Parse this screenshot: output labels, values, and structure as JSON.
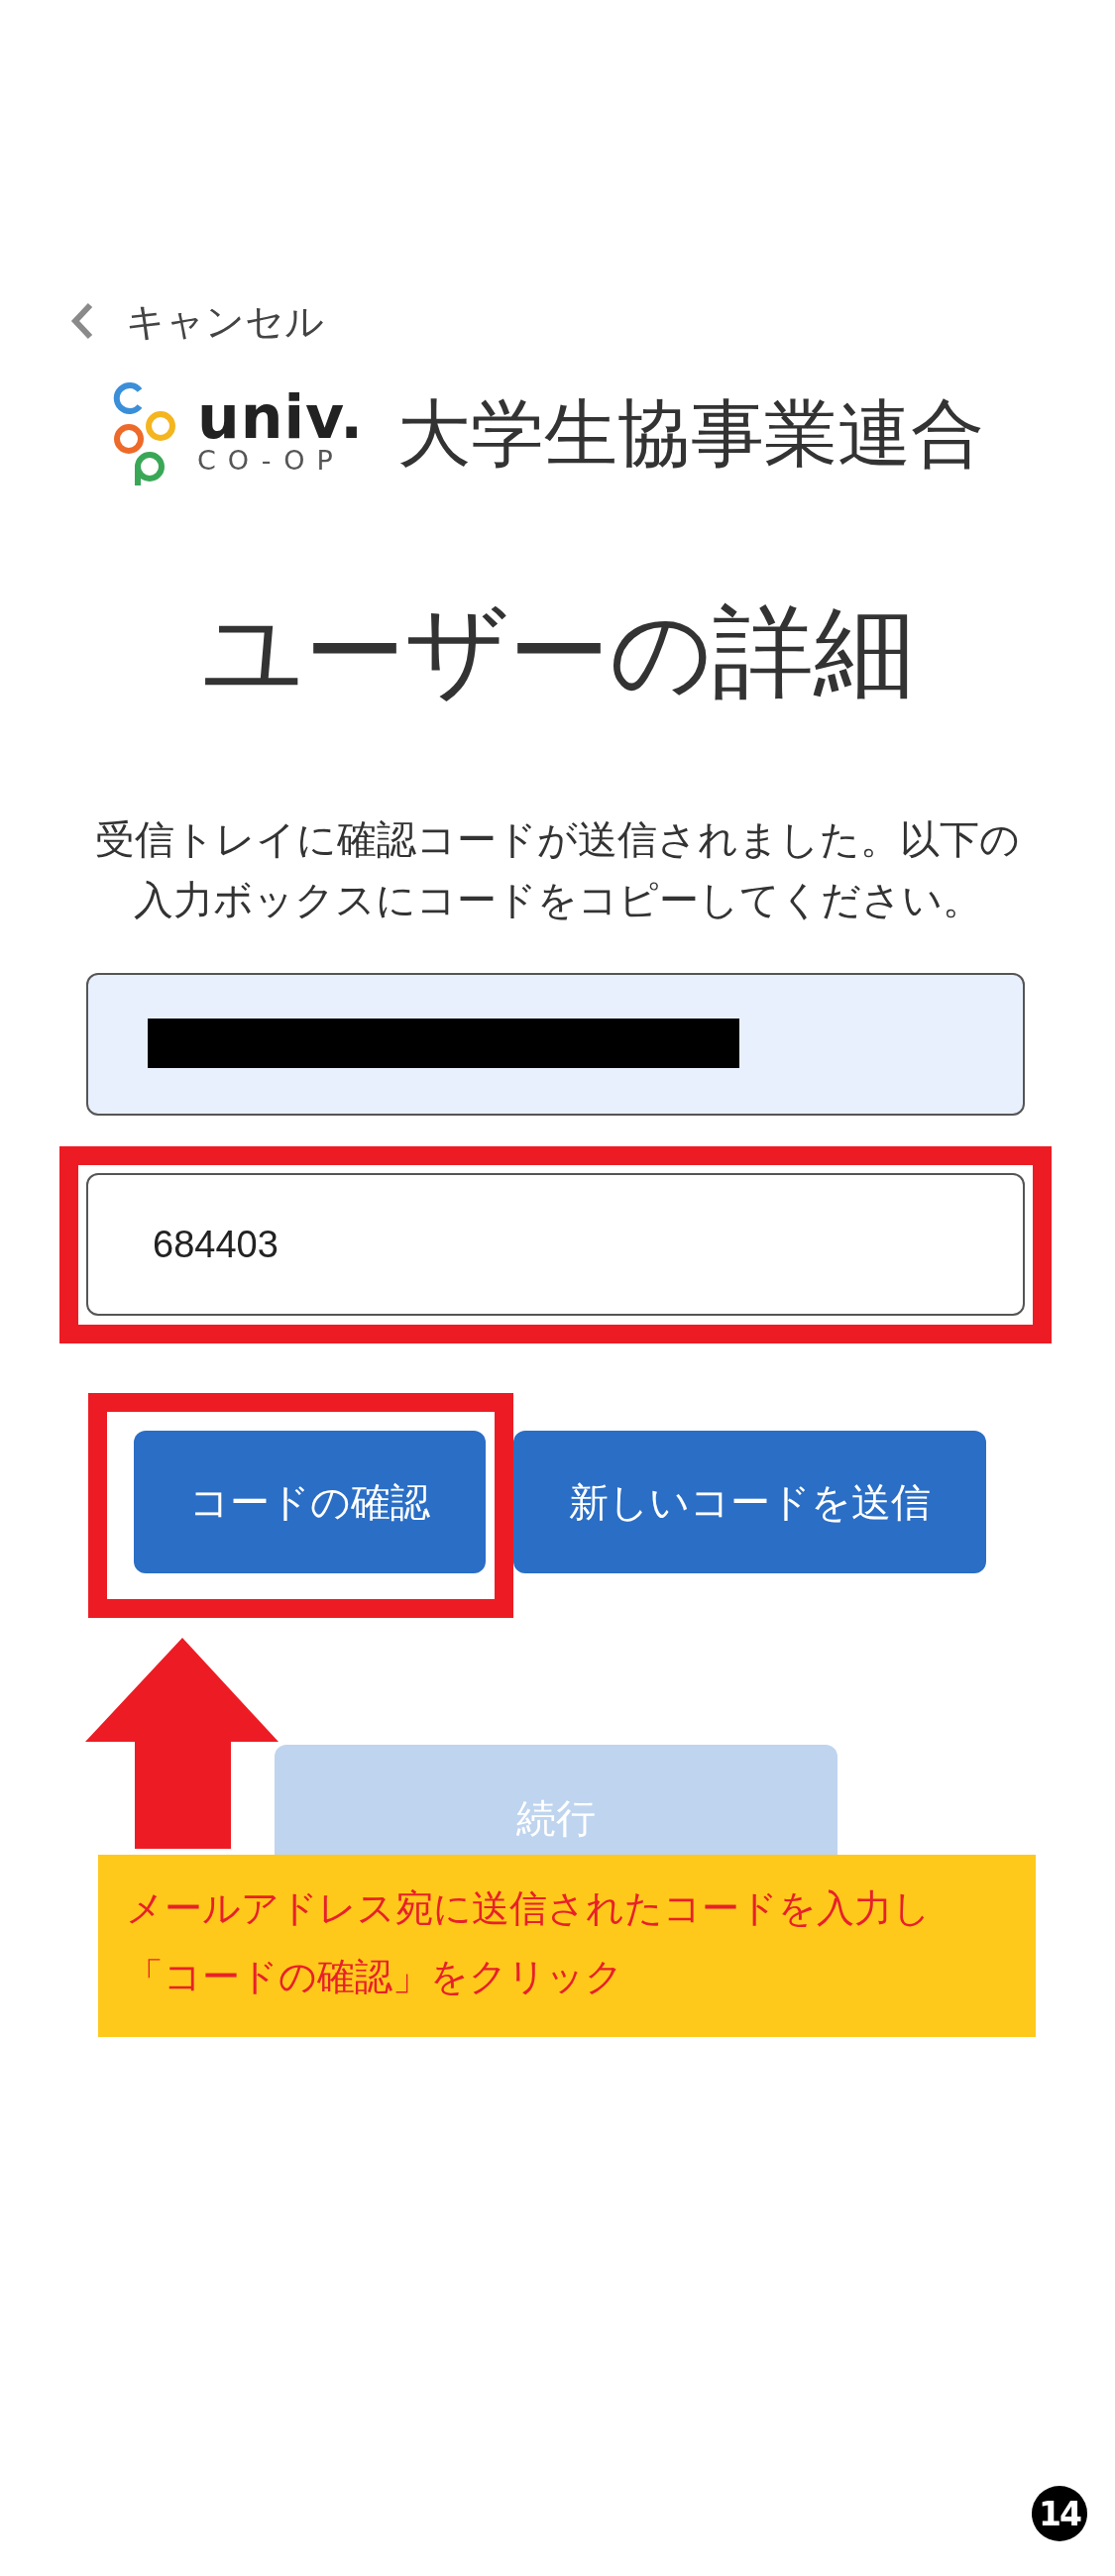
{
  "header": {
    "back_label": "キャンセル"
  },
  "logo": {
    "wordmark": "univ.",
    "subtext": "CO-OP",
    "name": "大学生協事業連合"
  },
  "title": "ユーザーの詳細",
  "message": "受信トレイに確認コードが送信されました。以下の入力ボックスにコードをコピーしてください。",
  "email_field": {
    "redacted": true
  },
  "code_field": {
    "value": "684403",
    "highlighted": true
  },
  "buttons": [
    {
      "label": "コードの確認",
      "highlighted": true
    },
    {
      "label": "新しいコードを送信",
      "highlighted": false
    }
  ],
  "continue_button": {
    "label": "続行",
    "disabled": true
  },
  "callout": {
    "lines": [
      "メールアドレス宛に送信されたコードを入力し",
      "「コードの確認」をクリック"
    ]
  },
  "page_number": "14"
}
